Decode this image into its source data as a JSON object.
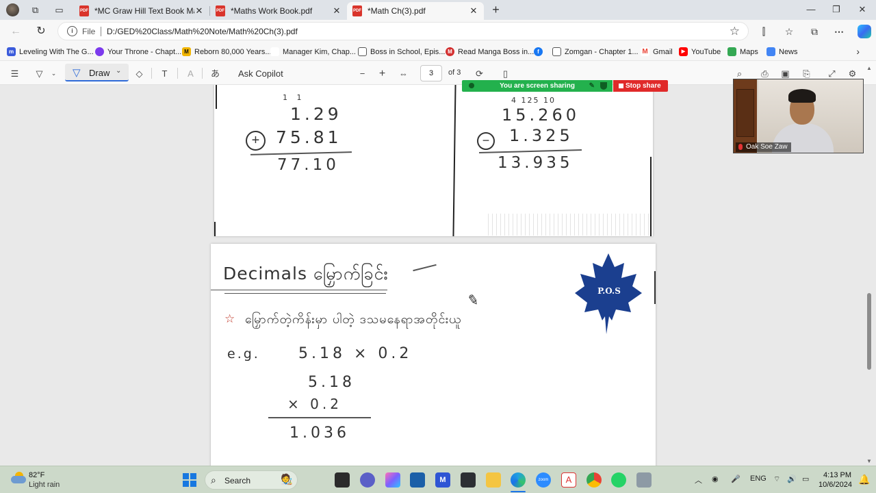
{
  "tabs": [
    {
      "label": "*MC Graw Hill Text Book Math.pd",
      "active": false
    },
    {
      "label": "*Maths Work Book.pdf",
      "active": false
    },
    {
      "label": "*Math Ch(3).pdf",
      "active": true
    }
  ],
  "address": {
    "scheme": "File",
    "url": "D:/GED%20Class/Math%20Note/Math%20Ch(3).pdf"
  },
  "favorites": [
    {
      "label": "Leveling With The G...",
      "icon": "blue-m-icon",
      "color": "#3b5bdb"
    },
    {
      "label": "Your Throne - Chapt...",
      "icon": "yt-dark-icon",
      "color": "#7c3aed"
    },
    {
      "label": "Reborn 80,000 Years...",
      "icon": "m-yellow-icon",
      "color": "#f0b400"
    },
    {
      "label": "Manager Kim, Chap...",
      "icon": "blank-icon",
      "color": "#ffffff"
    },
    {
      "label": "Boss in School, Epis...",
      "icon": "page-icon",
      "color": "#888888"
    },
    {
      "label": "Read Manga Boss in...",
      "icon": "red-m-icon",
      "color": "#d32f2f"
    },
    {
      "label": "",
      "icon": "facebook-icon",
      "color": "#1877f2"
    },
    {
      "label": "Zomgan - Chapter 1...",
      "icon": "page-icon",
      "color": "#888888"
    },
    {
      "label": "Gmail",
      "icon": "gmail-icon",
      "color": "#ea4335"
    },
    {
      "label": "YouTube",
      "icon": "youtube-icon",
      "color": "#ff0000"
    },
    {
      "label": "Maps",
      "icon": "maps-icon",
      "color": "#34a853"
    },
    {
      "label": "News",
      "icon": "news-icon",
      "color": "#4285f4"
    }
  ],
  "pdf_toolbar": {
    "draw_label": "Draw",
    "copilot_label": "Ask Copilot",
    "page_current": "3",
    "page_total": "of 3"
  },
  "page1": {
    "add": {
      "carry": "1  1",
      "top": "1.29",
      "op": "+",
      "bottom": "75.81",
      "result": "77.10"
    },
    "sub": {
      "carry": "4 125 10",
      "top": "15.260",
      "op": "−",
      "bottom": "1.325",
      "result": "13.935"
    }
  },
  "page2": {
    "title": "Decimals မြှောက်ခြင်း",
    "note": "မြှောက်တဲ့ကိန်းမှာ ပါတဲ့ ဒသမနေရာအတိုင်းယူ",
    "logo_text": "P.O.S",
    "eg_label": "e.g.",
    "problem": "5.18 × 0.2",
    "work_top": "5.18",
    "work_bottom": "× 0.2",
    "work_result": "1.036"
  },
  "zoom": {
    "share_text": "You are screen sharing",
    "stop_text": "Stop share",
    "participant": "Oak Soe Zaw"
  },
  "taskbar": {
    "temp": "82°F",
    "condition": "Light rain",
    "search": "Search",
    "lang": "ENG",
    "time": "4:13 PM",
    "date": "10/6/2024"
  },
  "colors": {
    "accent": "#2f6bd8",
    "share_green": "#23b14d",
    "stop_red": "#e02a2a",
    "logo_blue": "#1b3f8f"
  }
}
